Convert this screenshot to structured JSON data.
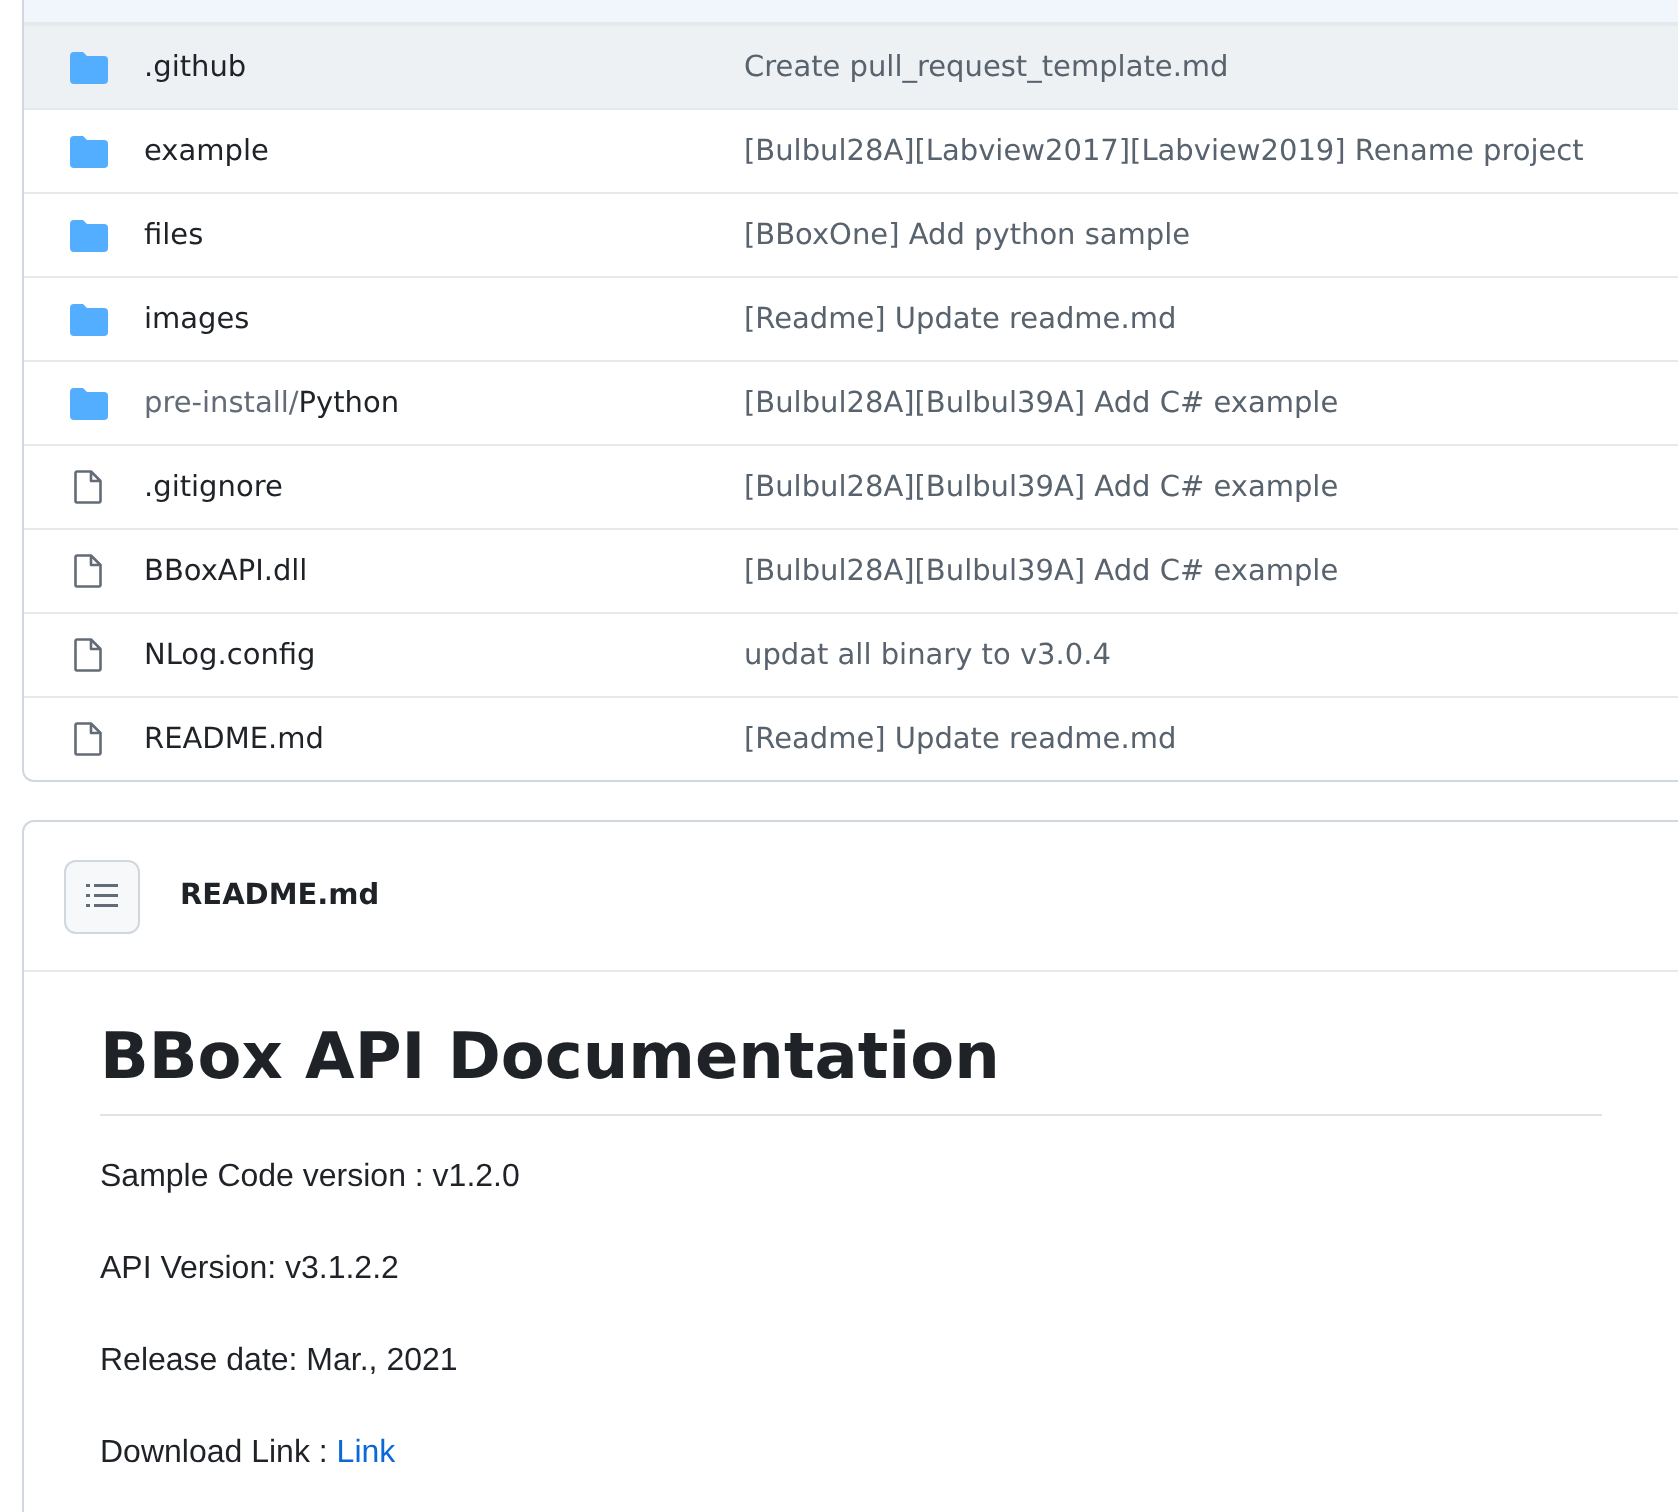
{
  "file_list": {
    "rows": [
      {
        "kind": "folder",
        "name": ".github",
        "message": "Create pull_request_template.md",
        "hovered": true
      },
      {
        "kind": "folder",
        "name": "example",
        "message": "[Bulbul28A][Labview2017][Labview2019] Rename project",
        "hovered": false
      },
      {
        "kind": "folder",
        "name": "files",
        "message": "[BBoxOne] Add python sample",
        "hovered": false
      },
      {
        "kind": "folder",
        "name": "images",
        "message": "[Readme] Update readme.md",
        "hovered": false
      },
      {
        "kind": "folder",
        "path": "pre-install/",
        "name": "Python",
        "message": "[Bulbul28A][Bulbul39A] Add C# example",
        "hovered": false
      },
      {
        "kind": "file",
        "name": ".gitignore",
        "message": "[Bulbul28A][Bulbul39A] Add C# example",
        "hovered": false
      },
      {
        "kind": "file",
        "name": "BBoxAPI.dll",
        "message": "[Bulbul28A][Bulbul39A] Add C# example",
        "hovered": false
      },
      {
        "kind": "file",
        "name": "NLog.config",
        "message": "updat all binary to v3.0.4",
        "hovered": false
      },
      {
        "kind": "file",
        "name": "README.md",
        "message": "[Readme] Update readme.md",
        "hovered": false
      }
    ]
  },
  "readme": {
    "file_name": "README.md",
    "heading": "BBox API Documentation",
    "paragraphs": [
      {
        "text": "Sample Code version : v1.2.0"
      },
      {
        "text": "API Version: v3.1.2.2"
      },
      {
        "text": "Release date: Mar., 2021"
      },
      {
        "text": "Download Link : ",
        "link": "Link"
      }
    ]
  }
}
